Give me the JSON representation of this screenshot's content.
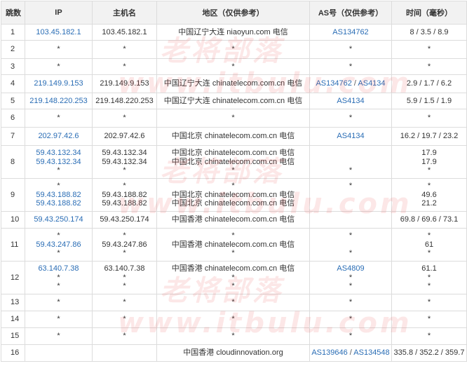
{
  "columns": [
    "跳数",
    "IP",
    "主机名",
    "地区（仅供参考）",
    "AS号（仅供参考）",
    "时间（毫秒）"
  ],
  "hops": [
    {
      "hop": "1",
      "lines": [
        {
          "ip": "103.45.182.1",
          "host": "103.45.182.1",
          "region": "中国辽宁大连 niaoyun.com 电信",
          "as": [
            "AS134762"
          ],
          "time": "8 / 3.5 / 8.9"
        }
      ]
    },
    {
      "hop": "2",
      "lines": [
        {
          "ip": "*",
          "host": "*",
          "region": "*",
          "as": [
            "*"
          ],
          "time": "*"
        }
      ]
    },
    {
      "hop": "3",
      "lines": [
        {
          "ip": "*",
          "host": "*",
          "region": "*",
          "as": [
            "*"
          ],
          "time": "*"
        }
      ]
    },
    {
      "hop": "4",
      "lines": [
        {
          "ip": "219.149.9.153",
          "host": "219.149.9.153",
          "region": "中国辽宁大连 chinatelecom.com.cn 电信",
          "as": [
            "AS134762",
            "AS4134"
          ],
          "time": "2.9 / 1.7 / 6.2"
        }
      ]
    },
    {
      "hop": "5",
      "lines": [
        {
          "ip": "219.148.220.253",
          "host": "219.148.220.253",
          "region": "中国辽宁大连 chinatelecom.com.cn 电信",
          "as": [
            "AS4134"
          ],
          "time": "5.9 / 1.5 / 1.9"
        }
      ]
    },
    {
      "hop": "6",
      "lines": [
        {
          "ip": "*",
          "host": "*",
          "region": "*",
          "as": [
            "*"
          ],
          "time": "*"
        }
      ]
    },
    {
      "hop": "7",
      "lines": [
        {
          "ip": "202.97.42.6",
          "host": "202.97.42.6",
          "region": "中国北京 chinatelecom.com.cn 电信",
          "as": [
            "AS4134"
          ],
          "time": "16.2 / 19.7 / 23.2"
        }
      ]
    },
    {
      "hop": "8",
      "lines": [
        {
          "ip": "59.43.132.34",
          "host": "59.43.132.34",
          "region": "中国北京 chinatelecom.com.cn 电信",
          "as": [
            ""
          ],
          "time": "17.9"
        },
        {
          "ip": "59.43.132.34",
          "host": "59.43.132.34",
          "region": "中国北京 chinatelecom.com.cn 电信",
          "as": [
            ""
          ],
          "time": "17.9"
        },
        {
          "ip": "*",
          "host": "*",
          "region": "*",
          "as": [
            "*"
          ],
          "time": "*"
        }
      ]
    },
    {
      "hop": "9",
      "lines": [
        {
          "ip": "*",
          "host": "*",
          "region": "*",
          "as": [
            "*"
          ],
          "time": "*"
        },
        {
          "ip": "59.43.188.82",
          "host": "59.43.188.82",
          "region": "中国北京 chinatelecom.com.cn 电信",
          "as": [
            ""
          ],
          "time": "49.6"
        },
        {
          "ip": "59.43.188.82",
          "host": "59.43.188.82",
          "region": "中国北京 chinatelecom.com.cn 电信",
          "as": [
            ""
          ],
          "time": "21.2"
        }
      ]
    },
    {
      "hop": "10",
      "lines": [
        {
          "ip": "59.43.250.174",
          "host": "59.43.250.174",
          "region": "中国香港 chinatelecom.com.cn 电信",
          "as": [
            ""
          ],
          "time": "69.8 / 69.6 / 73.1"
        }
      ]
    },
    {
      "hop": "11",
      "lines": [
        {
          "ip": "*",
          "host": "*",
          "region": "*",
          "as": [
            "*"
          ],
          "time": "*"
        },
        {
          "ip": "59.43.247.86",
          "host": "59.43.247.86",
          "region": "中国香港 chinatelecom.com.cn 电信",
          "as": [
            ""
          ],
          "time": "61"
        },
        {
          "ip": "*",
          "host": "*",
          "region": "*",
          "as": [
            "*"
          ],
          "time": "*"
        }
      ]
    },
    {
      "hop": "12",
      "lines": [
        {
          "ip": "63.140.7.38",
          "host": "63.140.7.38",
          "region": "中国香港 chinatelecom.com.cn 电信",
          "as": [
            "AS4809"
          ],
          "time": "61.1"
        },
        {
          "ip": "*",
          "host": "*",
          "region": "*",
          "as": [
            "*"
          ],
          "time": "*"
        },
        {
          "ip": "*",
          "host": "*",
          "region": "*",
          "as": [
            "*"
          ],
          "time": "*"
        }
      ]
    },
    {
      "hop": "13",
      "lines": [
        {
          "ip": "*",
          "host": "*",
          "region": "*",
          "as": [
            "*"
          ],
          "time": "*"
        }
      ]
    },
    {
      "hop": "14",
      "lines": [
        {
          "ip": "*",
          "host": "*",
          "region": "*",
          "as": [
            "*"
          ],
          "time": "*"
        }
      ]
    },
    {
      "hop": "15",
      "lines": [
        {
          "ip": "*",
          "host": "*",
          "region": "*",
          "as": [
            "*"
          ],
          "time": "*"
        }
      ]
    },
    {
      "hop": "16",
      "lines": [
        {
          "ip": "",
          "host": "",
          "region": "中国香港 cloudinnovation.org",
          "as": [
            "AS139646",
            "AS134548"
          ],
          "time": "335.8 / 352.2 / 359.7",
          "redacted": true
        }
      ]
    }
  ],
  "watermarks": [
    "老将部落",
    "www.itbulu.com"
  ],
  "colors": {
    "link": "#2a6db5",
    "header_bg": "#f2f2f2",
    "border": "#dcdcdc",
    "watermark": "#e84646"
  }
}
